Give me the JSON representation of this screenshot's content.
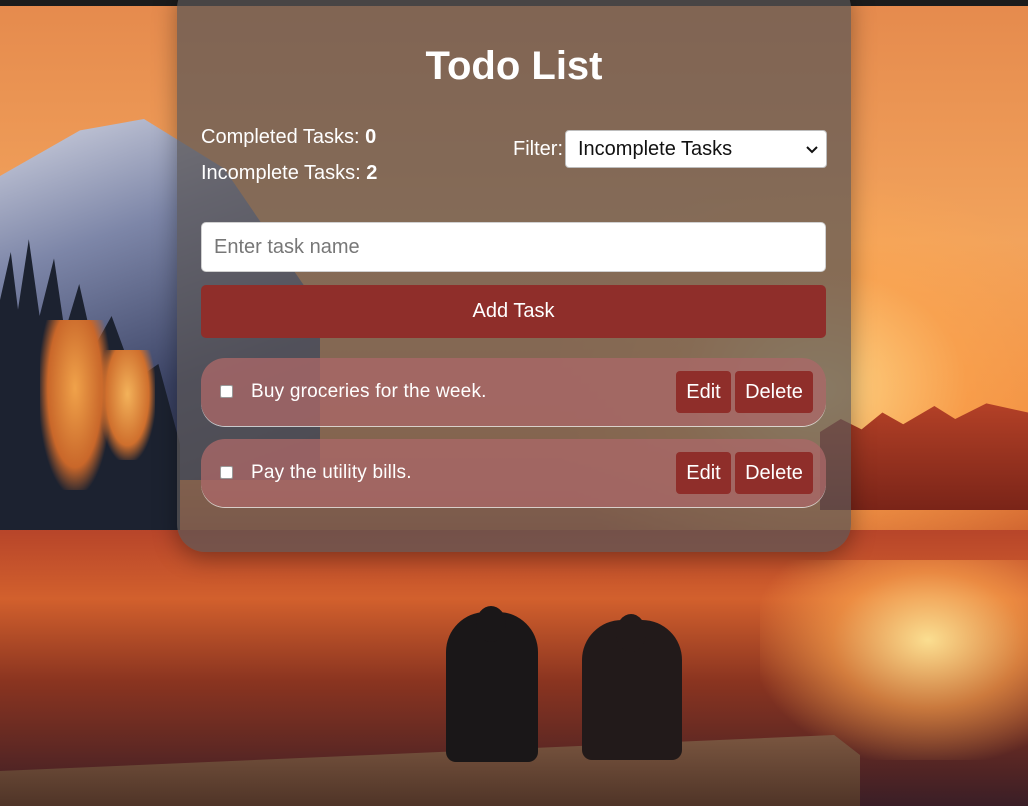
{
  "app": {
    "title": "Todo List"
  },
  "stats": {
    "completed_label": "Completed Tasks:",
    "completed_count": "0",
    "incomplete_label": "Incomplete Tasks:",
    "incomplete_count": "2"
  },
  "filter": {
    "label": "Filter:",
    "selected": "Incomplete Tasks"
  },
  "new_task": {
    "placeholder": "Enter task name",
    "value": "",
    "add_label": "Add Task"
  },
  "tasks": [
    {
      "text": "Buy groceries for the week.",
      "completed": false,
      "edit_label": "Edit",
      "delete_label": "Delete"
    },
    {
      "text": "Pay the utility bills.",
      "completed": false,
      "edit_label": "Edit",
      "delete_label": "Delete"
    }
  ],
  "colors": {
    "accent": "#8f2e2a",
    "card_background": "rgba(90,86,86,0.72)",
    "task_background": "rgba(170,104,104,0.78)",
    "text": "#ffffff"
  },
  "icons": {
    "filter_dropdown": "chevron-down-icon"
  }
}
